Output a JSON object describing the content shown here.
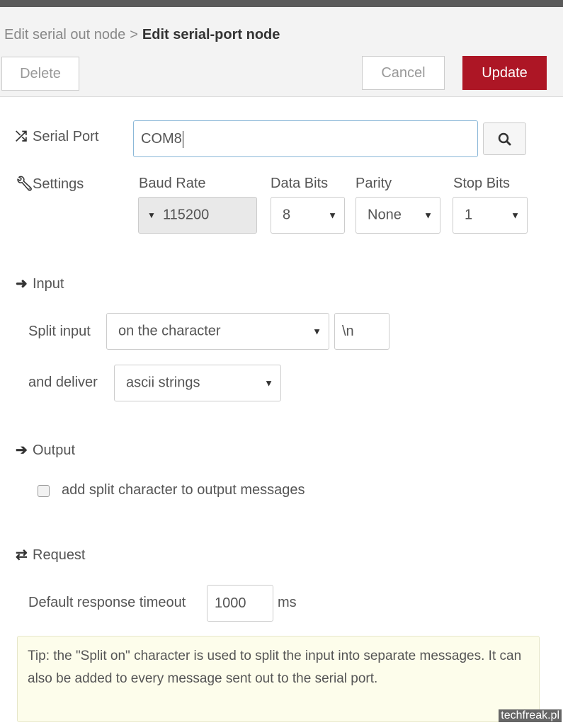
{
  "breadcrumb": {
    "previous": "Edit serial out node",
    "separator": ">",
    "current": "Edit serial-port node"
  },
  "toolbar": {
    "delete_label": "Delete",
    "cancel_label": "Cancel",
    "update_label": "Update"
  },
  "serial_port": {
    "label": "Serial Port",
    "value": "COM8",
    "search_icon": "search-icon"
  },
  "settings": {
    "label": "Settings",
    "baud_rate": {
      "label": "Baud Rate",
      "value": "115200"
    },
    "data_bits": {
      "label": "Data Bits",
      "value": "8"
    },
    "parity": {
      "label": "Parity",
      "value": "None"
    },
    "stop_bits": {
      "label": "Stop Bits",
      "value": "1"
    }
  },
  "input": {
    "section_label": "Input",
    "split_label": "Split input",
    "split_value": "on the character",
    "split_char": "\\n",
    "deliver_label": "and deliver",
    "deliver_value": "ascii strings"
  },
  "output": {
    "section_label": "Output",
    "checkbox_label": "add split character to output messages",
    "checked": false
  },
  "request": {
    "section_label": "Request",
    "timeout_label": "Default response timeout",
    "timeout_value": "1000",
    "timeout_unit": "ms"
  },
  "tip": "Tip: the \"Split on\" character is used to split the input into separate messages. It can also be added to every message sent out to the serial port.",
  "watermark": "techfreak.pl",
  "colors": {
    "primary": "#ad1625",
    "tip_bg": "#fdfdeb",
    "focus_border": "#8bb8d8"
  }
}
